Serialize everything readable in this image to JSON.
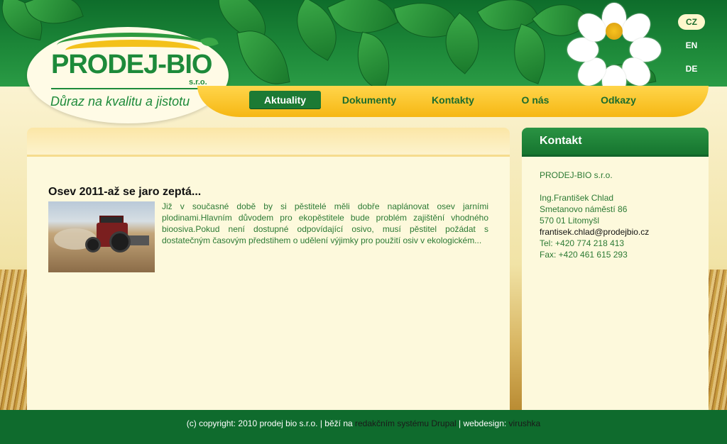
{
  "brand": {
    "name": "PRODEJ-BIO",
    "suffix": "s.r.o.",
    "tagline": "Důraz na kvalitu a jistotu"
  },
  "languages": [
    {
      "code": "CZ",
      "active": true
    },
    {
      "code": "EN",
      "active": false
    },
    {
      "code": "DE",
      "active": false
    }
  ],
  "nav": [
    {
      "label": "Aktuality",
      "active": true
    },
    {
      "label": "Dokumenty",
      "active": false
    },
    {
      "label": "Kontakty",
      "active": false
    },
    {
      "label": "O nás",
      "active": false
    },
    {
      "label": "Odkazy",
      "active": false
    }
  ],
  "article": {
    "title": "Osev 2011-až se jaro zeptá...",
    "text": "Již v současné době by si pěstitelé měli dobře naplánovat osev jarními plodinami.Hlavním důvodem pro ekopěstitele bude problém zajištění vhodného bioosiva.Pokud není dostupné odpovídající osivo, musí pěstitel požádat s dostatečným časovým předstihem o udělení výjimky pro použití osiv v ekologickém..."
  },
  "sidebar": {
    "title": "Kontakt",
    "company": "PRODEJ-BIO s.r.o.",
    "person": "Ing.František Chlad",
    "street": "Smetanovo náměstí 86",
    "city": "570 01 Litomyšl",
    "email": "frantisek.chlad@prodejbio.cz",
    "phone": "Tel: +420 774 218 413",
    "fax": "Fax: +420 461 615 293"
  },
  "footer": {
    "copyright": "(c) copyright: 2010 prodej bio s.r.o. | běží na ",
    "cms_link": "redakčním systému Drupal",
    "separator": " | webdesign: ",
    "design_link": "virushka"
  },
  "colors": {
    "brand_green": "#1d8a3a",
    "nav_yellow": "#f6b713",
    "footer_green": "#0f6b2d"
  }
}
